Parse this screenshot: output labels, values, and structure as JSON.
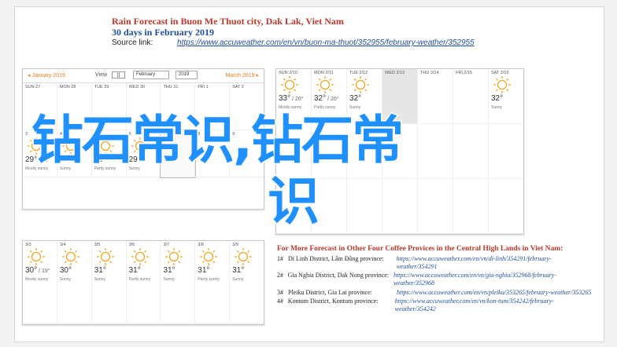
{
  "header": {
    "title": "Rain Forecast in Buon Me Thuot city, Dak Lak, Viet Nam",
    "subtitle": "30 days in February 2019",
    "source_label": "Source link:",
    "source_url": "https://www.accuweather.com/en/vn/buon-ma-thuot/352955/february-weather/352955"
  },
  "calendar": {
    "prev_month": "◂ January 2019",
    "next_month": "March 2019 ▸",
    "view_label": "View",
    "month_select": "February",
    "year_select": "2019"
  },
  "panel1": {
    "row1": [
      {
        "day": "SUN 27",
        "temp": "",
        "desc": ""
      },
      {
        "day": "MON 28",
        "temp": "",
        "desc": ""
      },
      {
        "day": "TUE 29",
        "temp": "",
        "desc": ""
      },
      {
        "day": "WED 30",
        "temp": "",
        "desc": ""
      },
      {
        "day": "THU 31",
        "temp": "",
        "desc": ""
      },
      {
        "day": "FRI 1",
        "temp": "",
        "desc": ""
      },
      {
        "day": "SAT 2",
        "temp": "",
        "desc": ""
      }
    ],
    "row2": [
      {
        "day": "3",
        "temp": "29°",
        "low": "22°",
        "desc": "Mostly sunny"
      },
      {
        "day": "4",
        "temp": "29°",
        "low": "",
        "desc": "Sunny"
      },
      {
        "day": "5",
        "temp": "29°",
        "low": "",
        "desc": "Partly sunny"
      },
      {
        "day": "6",
        "temp": "29°",
        "low": "",
        "desc": "Sunny"
      },
      {
        "day": "TODAY 7",
        "temp": "",
        "low": "",
        "desc": ""
      },
      {
        "day": "8",
        "temp": "",
        "low": "",
        "desc": ""
      },
      {
        "day": "9",
        "temp": "",
        "low": "",
        "desc": ""
      }
    ]
  },
  "panel2": {
    "row1": [
      {
        "day": "SUN 2/10",
        "temp": "33°",
        "low": "20°",
        "desc": "Mostly sunny"
      },
      {
        "day": "MON 2/11",
        "temp": "32°",
        "low": "20°",
        "desc": "Partly sunny"
      },
      {
        "day": "TUE 2/12",
        "temp": "32°",
        "low": "",
        "desc": "Sunny"
      },
      {
        "day": "WED 2/13",
        "temp": "",
        "low": "",
        "desc": ""
      },
      {
        "day": "THU 2/14",
        "temp": "",
        "low": "",
        "desc": ""
      },
      {
        "day": "FRI 2/15",
        "temp": "",
        "low": "",
        "desc": ""
      },
      {
        "day": "SAT 2/16",
        "temp": "32°",
        "low": "",
        "desc": "Sunny"
      }
    ],
    "row2": [
      {
        "day": "",
        "temp": "",
        "low": "",
        "desc": ""
      },
      {
        "day": "",
        "temp": "",
        "low": "",
        "desc": ""
      },
      {
        "day": "",
        "temp": "",
        "low": "",
        "desc": ""
      },
      {
        "day": "",
        "temp": "",
        "low": "",
        "desc": ""
      },
      {
        "day": "",
        "temp": "",
        "low": "",
        "desc": ""
      },
      {
        "day": "",
        "temp": "",
        "low": "",
        "desc": ""
      },
      {
        "day": "",
        "temp": "",
        "low": "",
        "desc": ""
      }
    ],
    "row3": [
      {
        "day": "",
        "temp": "",
        "low": "",
        "desc": ""
      },
      {
        "day": "",
        "temp": "",
        "low": "",
        "desc": ""
      },
      {
        "day": "",
        "temp": "",
        "low": "",
        "desc": ""
      },
      {
        "day": "",
        "temp": "",
        "low": "",
        "desc": ""
      },
      {
        "day": "",
        "temp": "",
        "low": "",
        "desc": ""
      },
      {
        "day": "",
        "temp": "",
        "low": "",
        "desc": ""
      },
      {
        "day": "",
        "temp": "",
        "low": "",
        "desc": ""
      }
    ]
  },
  "panel3": {
    "row1": [
      {
        "day": "3/3",
        "temp": "30°",
        "low": "19°",
        "desc": "Mostly sunny"
      },
      {
        "day": "3/4",
        "temp": "30°",
        "low": "",
        "desc": "Sunny"
      },
      {
        "day": "3/5",
        "temp": "31°",
        "low": "",
        "desc": "Sunny"
      },
      {
        "day": "3/6",
        "temp": "31°",
        "low": "",
        "desc": "Partly sunny"
      },
      {
        "day": "3/7",
        "temp": "31°",
        "low": "",
        "desc": "Sunny"
      },
      {
        "day": "3/8",
        "temp": "31°",
        "low": "",
        "desc": "Partly sunny"
      },
      {
        "day": "3/9",
        "temp": "31°",
        "low": "",
        "desc": "Sunny"
      }
    ]
  },
  "more": {
    "title": "For More Forecast in Other Four Coffee Provices in the Central High Lands in Viet Nam:",
    "items": [
      {
        "num": "1#",
        "name": "Di Linh District, Lâm Đồng province:",
        "url": "https://www.accuweather.com/en/vn/di-linh/354291/february-weather/354291"
      },
      {
        "num": "2#",
        "name": "Gia Nghia District, Dak Nong province:",
        "url": "https://www.accuweather.com/en/vn/gia-nghia/352968/february-weather/352968"
      },
      {
        "num": "3#",
        "name": "Pleiku District, Gia Lai province:",
        "url": "https://www.accuweather.com/en/vn/pleiku/353265/february-weather/353265"
      },
      {
        "num": "4#",
        "name": "Kontum District, Kontum province:",
        "url": "https://www.accuweather.com/en/vn/kon-tum/354242/february-weather/354242"
      }
    ]
  },
  "watermark": {
    "line1": "钻石常识,钻石常",
    "line2": "识"
  },
  "colors": {
    "accent_orange": "#e67e22",
    "title_red": "#c0392b",
    "link_blue": "#1f4e9e",
    "watermark_blue": "#1e90ff"
  }
}
